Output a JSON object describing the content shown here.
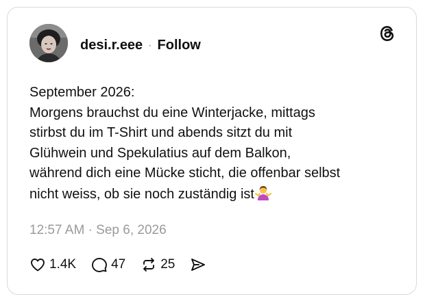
{
  "author": {
    "username": "desi.r.eee",
    "separator": "·",
    "follow_label": "Follow"
  },
  "post": {
    "lines": [
      "September 2026:",
      "Morgens brauchst du eine Winterjacke, mittags",
      "stirbst du im T-Shirt und abends sitzt du mit",
      "Glühwein und Spekulatius auf dem Balkon,",
      "während dich eine Mücke sticht, die offenbar selbst",
      "nicht weiss, ob sie noch zuständig ist"
    ],
    "emoji": "person-shrugging-emoji",
    "timestamp": "12:57 AM · Sep 6, 2026"
  },
  "actions": {
    "likes": "1.4K",
    "replies": "47",
    "reposts": "25"
  },
  "icons": {
    "logo": "threads-logo-icon",
    "like": "heart-icon",
    "reply": "comment-bubble-icon",
    "repost": "repost-icon",
    "share": "send-icon"
  },
  "colors": {
    "text": "#101010",
    "muted": "#9a9a9a",
    "border": "#d9d9d9"
  }
}
